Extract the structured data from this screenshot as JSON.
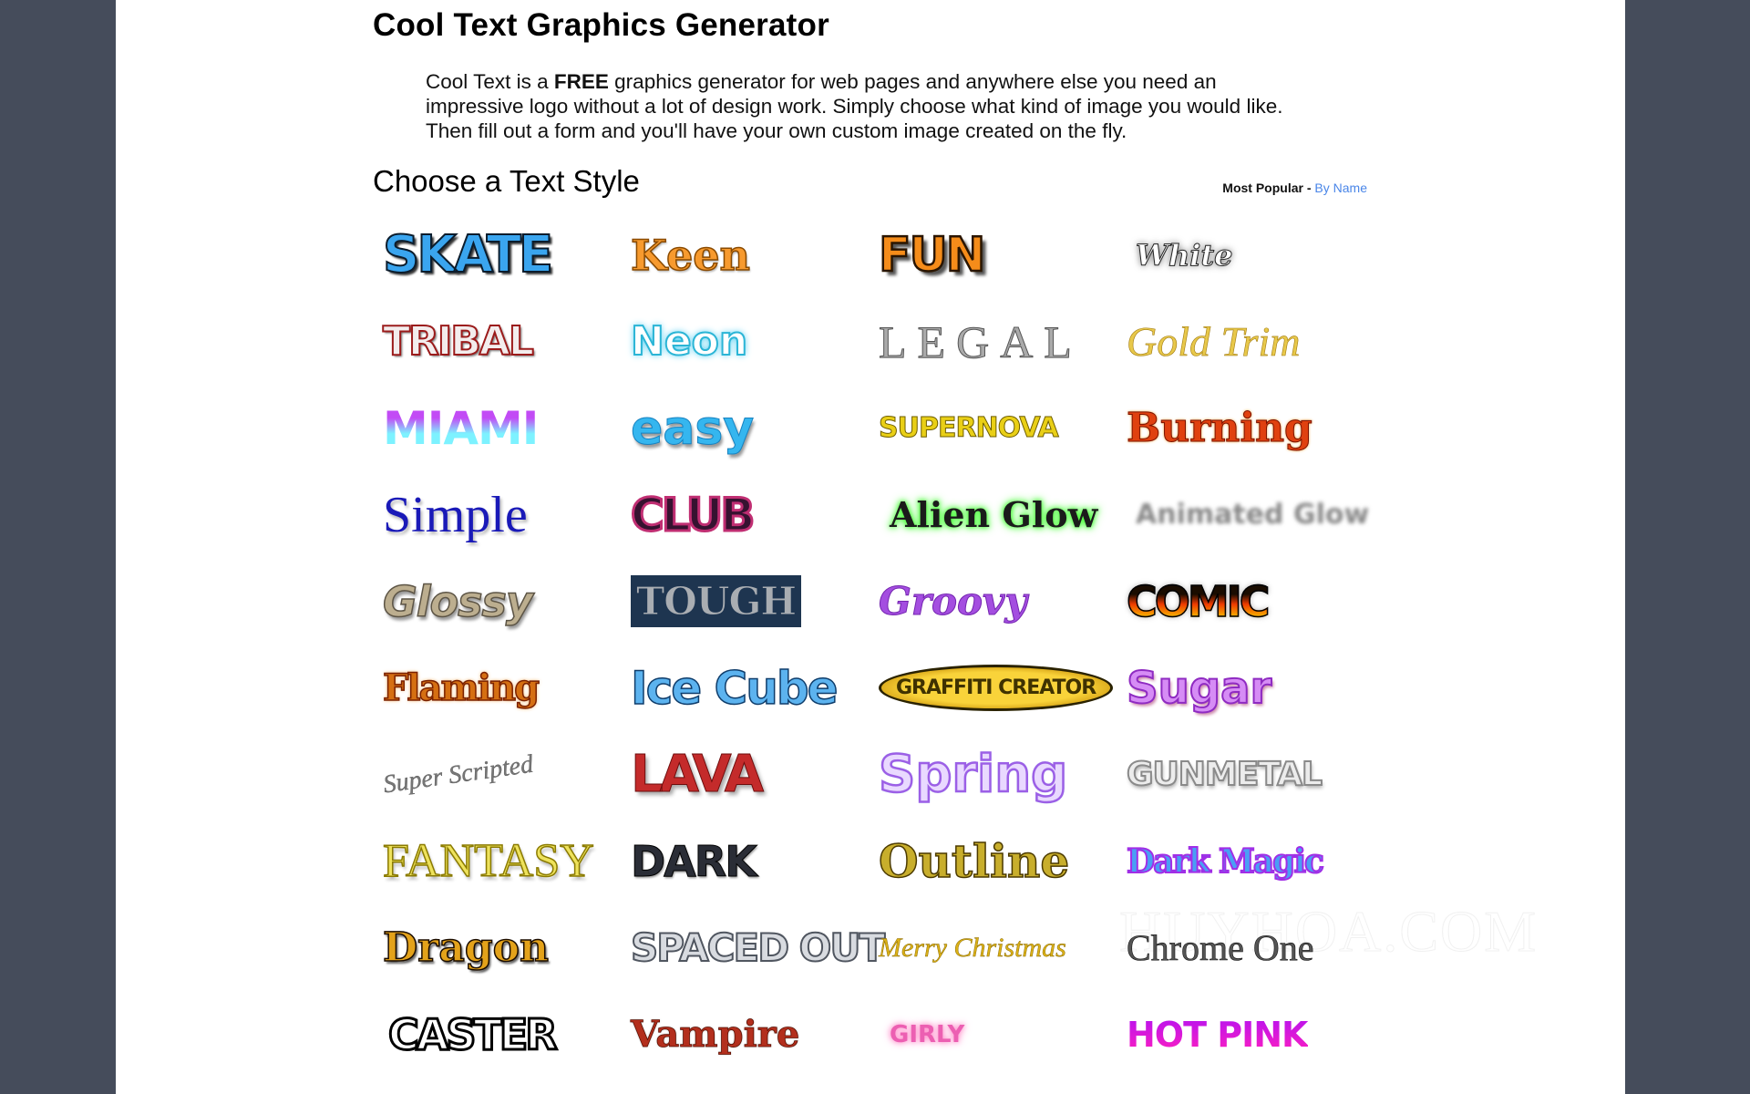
{
  "page": {
    "title": "Cool Text Graphics Generator",
    "intro": {
      "before": "Cool Text is a ",
      "bold": "FREE",
      "after": " graphics generator for web pages and anywhere else you need an impressive logo without a lot of design work. Simply choose what kind of image you would like. Then fill out a form and you'll have your own custom image created on the fly."
    },
    "section_title": "Choose a Text Style",
    "sort": {
      "current": "Most Popular",
      "separator": " - ",
      "alt_link": "By Name"
    },
    "watermark": "HUYHOA.COM"
  },
  "colors": {
    "background": "#454c5b",
    "panel": "#ffffff",
    "link": "#4a86e8"
  },
  "styles": [
    {
      "label": "SKATE",
      "name": "Skate"
    },
    {
      "label": "Keen",
      "name": "Keen"
    },
    {
      "label": "FUN",
      "name": "Fun"
    },
    {
      "label": "White",
      "name": "White"
    },
    {
      "label": "TRIBAL",
      "name": "Tribal"
    },
    {
      "label": "Neon",
      "name": "Neon"
    },
    {
      "label": "LEGAL",
      "name": "Legal"
    },
    {
      "label": "Gold Trim",
      "name": "Gold Trim"
    },
    {
      "label": "MIAMI",
      "name": "Miami"
    },
    {
      "label": "easy",
      "name": "Easy"
    },
    {
      "label": "SUPERNOVA",
      "name": "Supernova"
    },
    {
      "label": "Burning",
      "name": "Burning"
    },
    {
      "label": "Simple",
      "name": "Simple"
    },
    {
      "label": "CLUB",
      "name": "Club"
    },
    {
      "label": "Alien Glow",
      "name": "Alien Glow"
    },
    {
      "label": "Animated Glow",
      "name": "Animated Glow"
    },
    {
      "label": "Glossy",
      "name": "Glossy"
    },
    {
      "label": "TOUGH",
      "name": "Tough"
    },
    {
      "label": "Groovy",
      "name": "Groovy"
    },
    {
      "label": "COMIC",
      "name": "Comic"
    },
    {
      "label": "Flaming",
      "name": "Flaming"
    },
    {
      "label": "Ice Cube",
      "name": "Ice Cube"
    },
    {
      "label": "GRAFFITI CREATOR",
      "name": "Graffiti Creator"
    },
    {
      "label": "Sugar",
      "name": "Sugar"
    },
    {
      "label": "Super Scripted",
      "name": "Super Scripted"
    },
    {
      "label": "LAVA",
      "name": "Lava"
    },
    {
      "label": "Spring",
      "name": "Spring"
    },
    {
      "label": "GUNMETAL",
      "name": "Gunmetal"
    },
    {
      "label": "FANTASY",
      "name": "Fantasy"
    },
    {
      "label": "DARK",
      "name": "Dark"
    },
    {
      "label": "Outline",
      "name": "Outline"
    },
    {
      "label": "Dark Magic",
      "name": "Dark Magic"
    },
    {
      "label": "Dragon",
      "name": "Dragon"
    },
    {
      "label": "SPACED OUT",
      "name": "Spaced Out"
    },
    {
      "label": "Merry Christmas",
      "name": "Merry Christmas"
    },
    {
      "label": "Chrome One",
      "name": "Chrome One"
    },
    {
      "label": "CASTER",
      "name": "Caster"
    },
    {
      "label": "Vampire",
      "name": "Vampire"
    },
    {
      "label": "GIRLY",
      "name": "Girly"
    },
    {
      "label": "HOT PINK",
      "name": "Hot Pink"
    }
  ]
}
